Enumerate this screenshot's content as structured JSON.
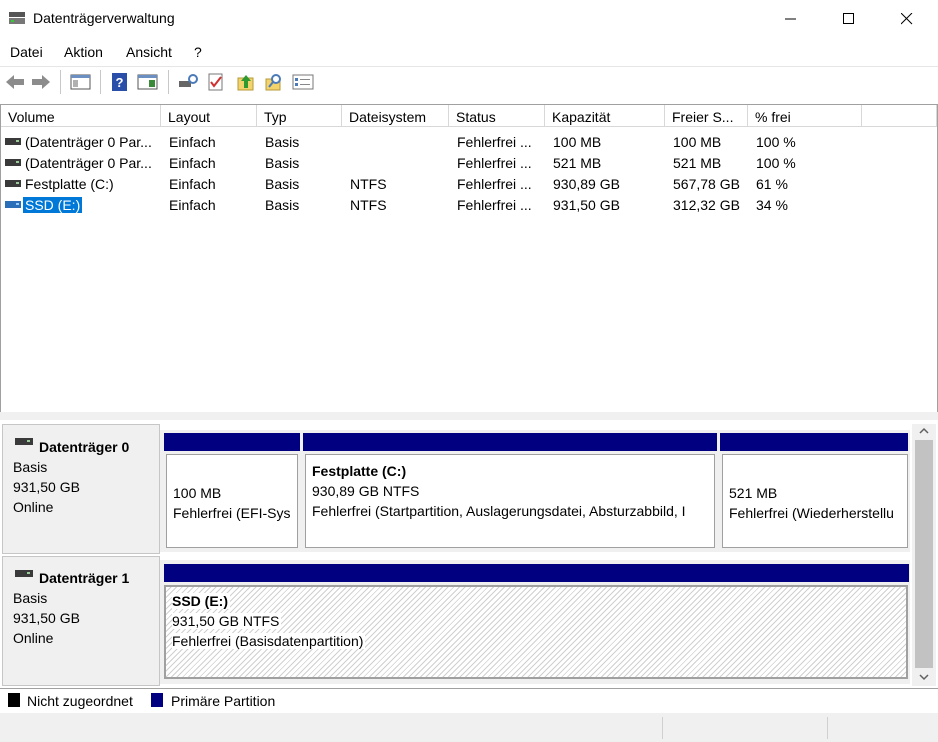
{
  "window": {
    "title": "Datenträgerverwaltung",
    "minimize_icon": "minimize-icon",
    "maximize_icon": "maximize-icon",
    "close_icon": "close-icon"
  },
  "menu": {
    "items": [
      "Datei",
      "Aktion",
      "Ansicht",
      "?"
    ]
  },
  "toolbar": {
    "icons": [
      "back-arrow-icon",
      "forward-arrow-icon",
      "show-hide-console-tree-icon",
      "help-icon",
      "show-hide-action-pane-icon",
      "connect-disk-icon",
      "check-properties-icon",
      "up-arrow-folder-icon",
      "search-folder-icon",
      "properties-list-icon"
    ]
  },
  "volume_table": {
    "columns": [
      "Volume",
      "Layout",
      "Typ",
      "Dateisystem",
      "Status",
      "Kapazität",
      "Freier S...",
      "% frei"
    ],
    "rows": [
      {
        "volume": "(Datenträger 0 Par...",
        "layout": "Einfach",
        "typ": "Basis",
        "fs": "",
        "status": "Fehlerfrei ...",
        "capacity": "100 MB",
        "free": "100 MB",
        "pct": "100 %"
      },
      {
        "volume": "(Datenträger 0 Par...",
        "layout": "Einfach",
        "typ": "Basis",
        "fs": "",
        "status": "Fehlerfrei ...",
        "capacity": "521 MB",
        "free": "521 MB",
        "pct": "100 %"
      },
      {
        "volume": "Festplatte (C:)",
        "layout": "Einfach",
        "typ": "Basis",
        "fs": "NTFS",
        "status": "Fehlerfrei ...",
        "capacity": "930,89 GB",
        "free": "567,78 GB",
        "pct": "61 %"
      },
      {
        "volume": "SSD (E:)",
        "layout": "Einfach",
        "typ": "Basis",
        "fs": "NTFS",
        "status": "Fehlerfrei ...",
        "capacity": "931,50 GB",
        "free": "312,32 GB",
        "pct": "34 %"
      }
    ]
  },
  "disks": [
    {
      "name": "Datenträger 0",
      "type": "Basis",
      "size": "931,50 GB",
      "state": "Online",
      "partitions": [
        {
          "title": "",
          "size": "100 MB",
          "status": "Fehlerfrei (EFI-Sys"
        },
        {
          "title": "Festplatte  (C:)",
          "size": "930,89 GB NTFS",
          "status": "Fehlerfrei (Startpartition, Auslagerungsdatei, Absturzabbild, I"
        },
        {
          "title": "",
          "size": "521 MB",
          "status": "Fehlerfrei (Wiederherstellu"
        }
      ]
    },
    {
      "name": "Datenträger 1",
      "type": "Basis",
      "size": "931,50 GB",
      "state": "Online",
      "partitions": [
        {
          "title": "SSD  (E:)",
          "size": "931,50 GB NTFS",
          "status": "Fehlerfrei (Basisdatenpartition)"
        }
      ]
    }
  ],
  "legend": {
    "unallocated": "Nicht zugeordnet",
    "primary": "Primäre Partition",
    "unallocated_color": "#000000",
    "primary_color": "#000080"
  },
  "colors": {
    "partition_bar": "#000080",
    "selection": "#0078d7"
  }
}
